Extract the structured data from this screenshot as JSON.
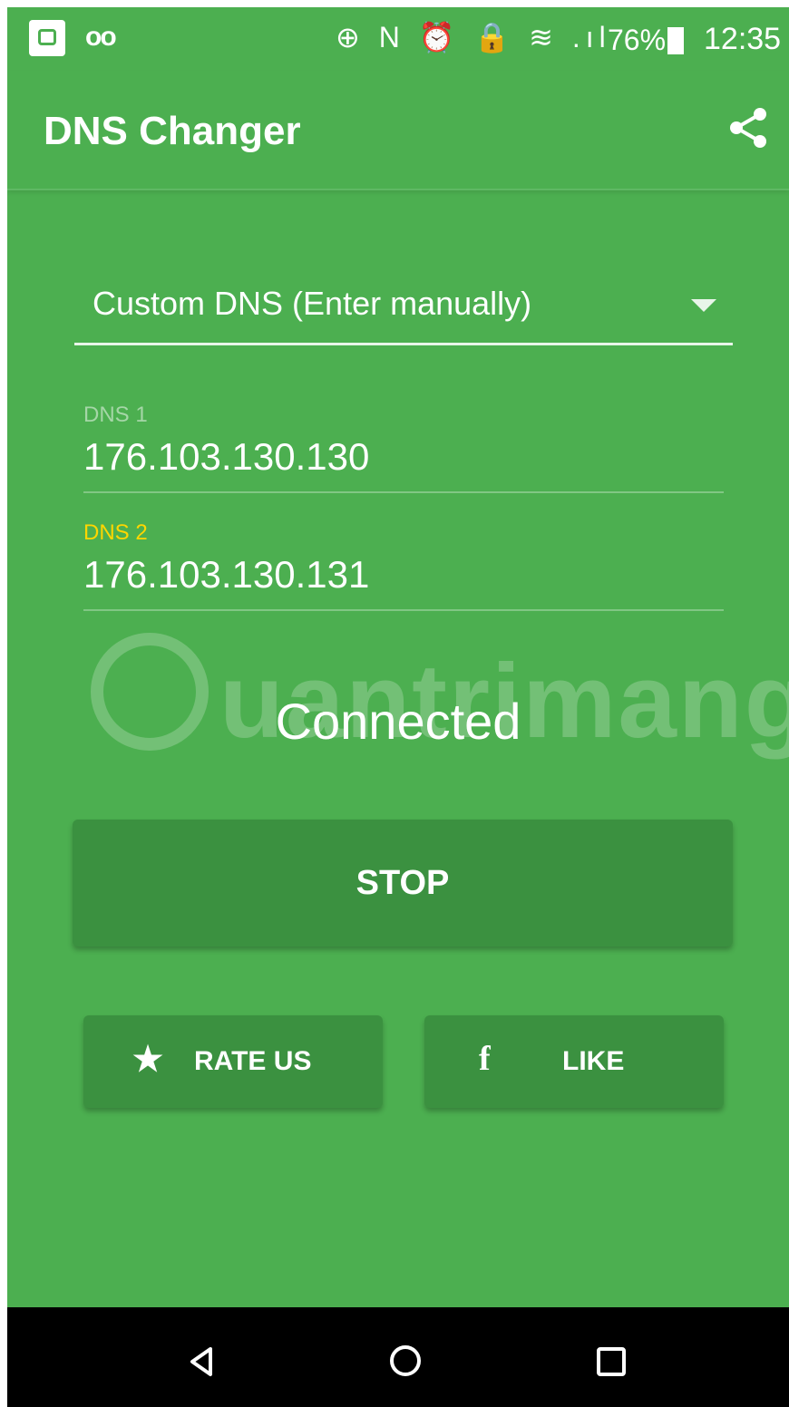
{
  "status_bar": {
    "voicemail": "oo",
    "icons": "⊕ N ⏰ 🔒 ≋ .ıl",
    "battery": "76%",
    "time": "12:35"
  },
  "app_bar": {
    "title": "DNS Changer",
    "share_icon": "share-icon"
  },
  "dns_selector": {
    "selected": "Custom DNS (Enter manually)"
  },
  "fields": [
    {
      "label": "DNS 1",
      "value": "176.103.130.130"
    },
    {
      "label": "DNS 2",
      "value": "176.103.130.131"
    }
  ],
  "status": "Connected",
  "watermark": "uantrimang",
  "buttons": {
    "stop": "STOP",
    "rate": "RATE US",
    "like": "LIKE"
  },
  "colors": {
    "primary": "#4caf50",
    "button": "#3b9140",
    "focused_label": "#ffd600"
  }
}
